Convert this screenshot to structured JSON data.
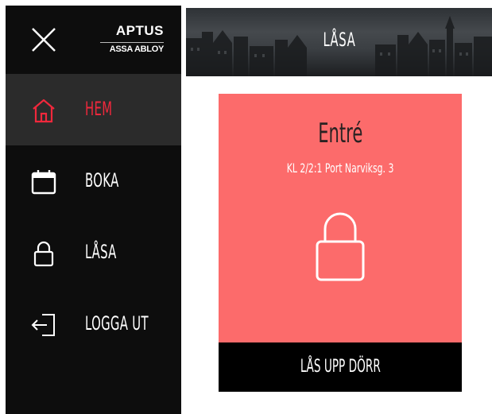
{
  "brand": {
    "name": "APTUS",
    "sub": "ASSA ABLOY"
  },
  "sidebar": {
    "items": [
      {
        "label": "HEM",
        "icon": "home-icon",
        "active": true
      },
      {
        "label": "BOKA",
        "icon": "calendar-icon",
        "active": false
      },
      {
        "label": "LÅSA",
        "icon": "lock-icon",
        "active": false
      },
      {
        "label": "LOGGA UT",
        "icon": "logout-icon",
        "active": false
      }
    ]
  },
  "header": {
    "title": "LÅSA"
  },
  "card": {
    "title": "Entré",
    "subtitle": "KL 2/2:1 Port Narviksg. 3",
    "button_label": "LÅS UPP DÖRR",
    "status_color": "#fc6b6b"
  },
  "colors": {
    "accent": "#f0283c",
    "sidebar_bg": "#0d0d0d",
    "active_bg": "#2b2b2b"
  }
}
